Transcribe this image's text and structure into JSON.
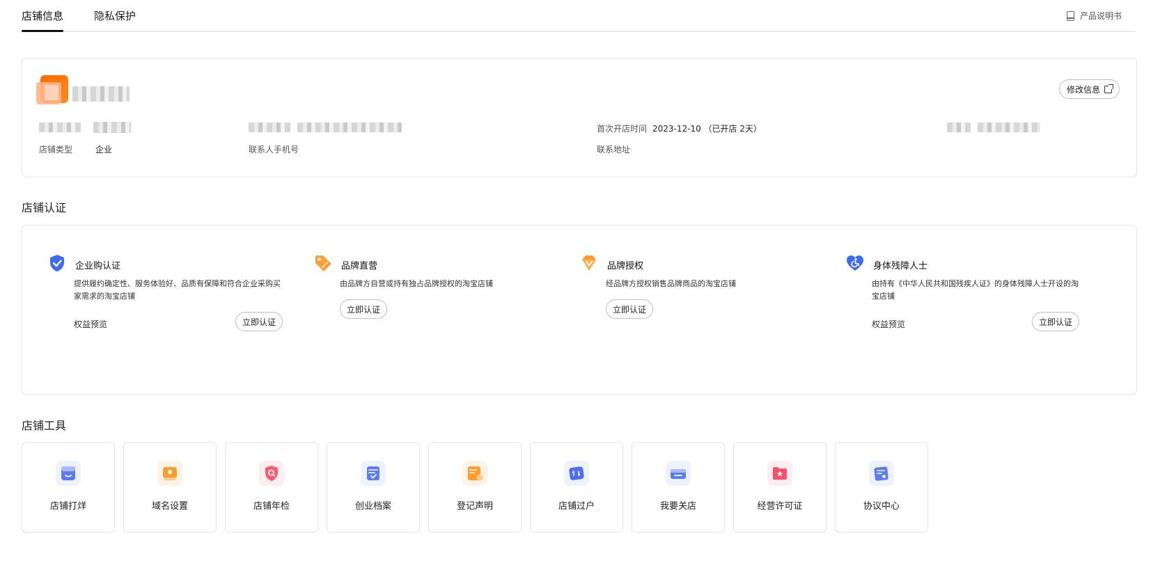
{
  "tabs": [
    {
      "label": "店铺信息",
      "active": true
    },
    {
      "label": "隐私保护",
      "active": false
    }
  ],
  "manual_link": "产品说明书",
  "store_info": {
    "edit_button": "修改信息",
    "first_open_label": "首次开店时间",
    "first_open_value": "2023-12-10 （已开店 2天）",
    "store_type_label": "店铺类型",
    "store_type_value": "企业",
    "contact_phone_label": "联系人手机号",
    "contact_address_label": "联系地址"
  },
  "certification": {
    "title": "店铺认证",
    "items": [
      {
        "icon": "shield-check-icon",
        "title": "企业购认证",
        "desc": "提供履约确定性、服务体验好、品质有保障和符合企业采购买家需求的淘宝店铺",
        "benefit": "权益预览",
        "button": "立即认证"
      },
      {
        "icon": "tag-icon",
        "title": "品牌直营",
        "desc": "由品牌方自营或持有独占品牌授权的淘宝店铺",
        "button": "立即认证"
      },
      {
        "icon": "diamond-icon",
        "title": "品牌授权",
        "desc": "经品牌方授权销售品牌商品的淘宝店铺",
        "button": "立即认证"
      },
      {
        "icon": "heart-accessibility-icon",
        "title": "身体残障人士",
        "desc": "由持有《中华人民共和国残疾人证》的身体残障人士开设的淘宝店铺",
        "benefit": "权益预览",
        "button": "立即认证"
      }
    ]
  },
  "tools": {
    "title": "店铺工具",
    "items": [
      {
        "label": "店铺打烊",
        "icon": "store-close-icon",
        "color": "#5b7cf5"
      },
      {
        "label": "域名设置",
        "icon": "domain-icon",
        "color": "#ff9d2e"
      },
      {
        "label": "店铺年检",
        "icon": "shield-search-icon",
        "color": "#ff5a6e"
      },
      {
        "label": "创业档案",
        "icon": "archive-icon",
        "color": "#5b7cf5"
      },
      {
        "label": "登记声明",
        "icon": "declaration-icon",
        "color": "#ff9d2e"
      },
      {
        "label": "店铺过户",
        "icon": "transfer-icon",
        "color": "#4c6ef5"
      },
      {
        "label": "我要关店",
        "icon": "close-store-icon",
        "color": "#5b7cf5"
      },
      {
        "label": "经营许可证",
        "icon": "license-icon",
        "color": "#ff4d6d"
      },
      {
        "label": "协议中心",
        "icon": "agreement-icon",
        "color": "#5b7cf5"
      }
    ]
  }
}
